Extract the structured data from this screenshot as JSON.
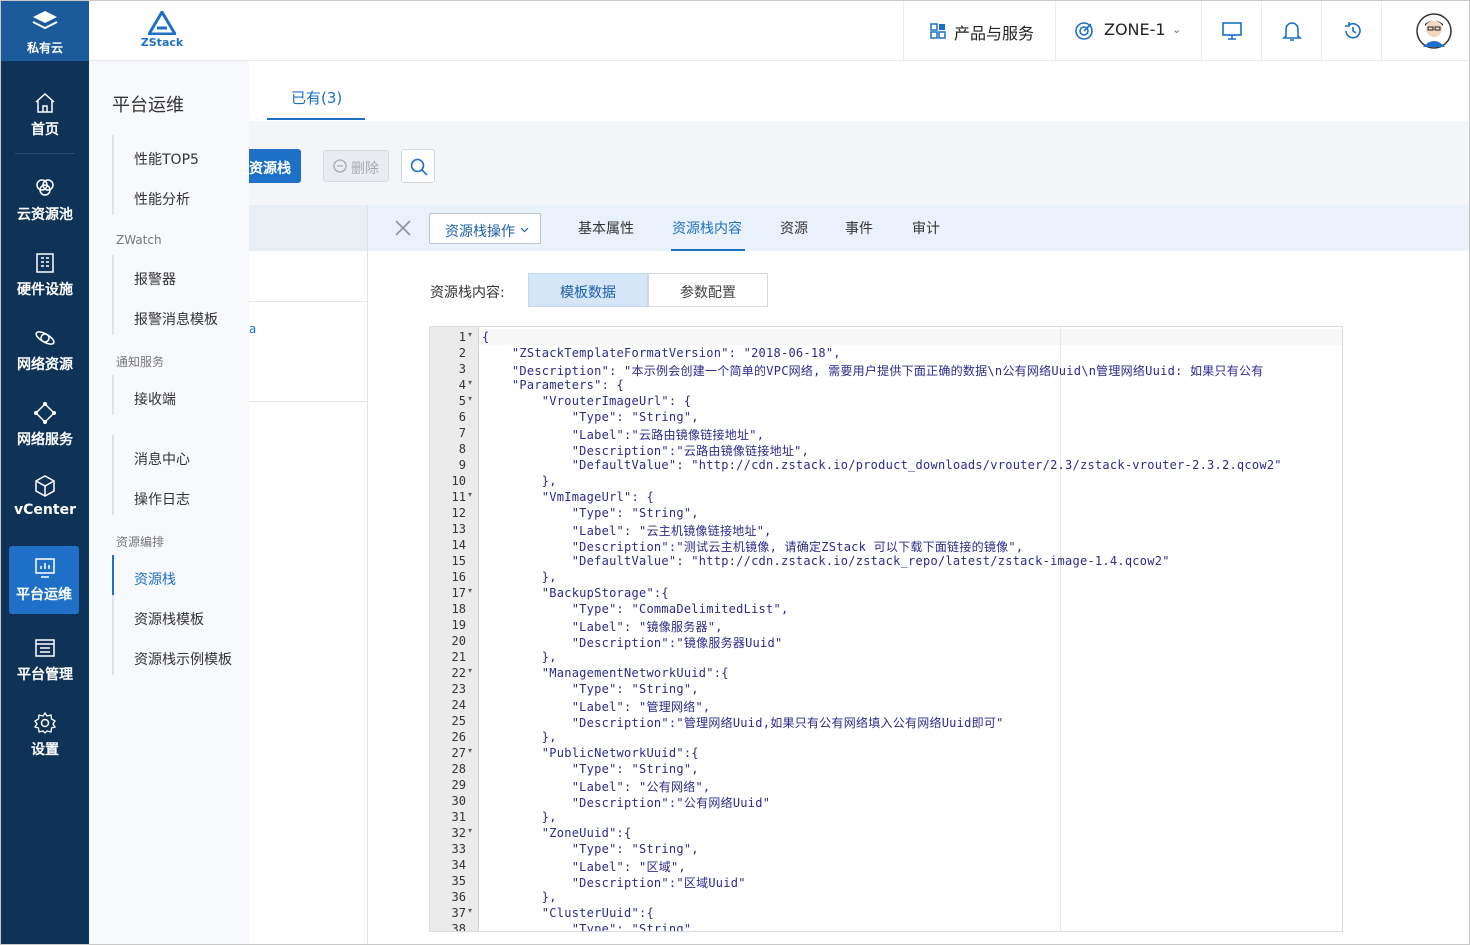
{
  "rail": {
    "top_label": "私有云",
    "items": [
      {
        "label": "首页",
        "icon": "home-icon"
      },
      {
        "label": "云资源池",
        "icon": "resource-pool-icon"
      },
      {
        "label": "硬件设施",
        "icon": "hardware-icon"
      },
      {
        "label": "网络资源",
        "icon": "network-resource-icon"
      },
      {
        "label": "网络服务",
        "icon": "network-service-icon"
      },
      {
        "label": "vCenter",
        "icon": "cube-icon"
      },
      {
        "label": "平台运维",
        "icon": "monitor-chart-icon"
      },
      {
        "label": "平台管理",
        "icon": "list-window-icon"
      },
      {
        "label": "设置",
        "icon": "gear-icon"
      }
    ],
    "active": "平台运维"
  },
  "header": {
    "logo_text": "ZStack",
    "products_label": "产品与服务",
    "zone_label": "ZONE-1"
  },
  "subnav": {
    "title": "平台运维",
    "items": [
      "性能TOP5",
      "性能分析",
      "报警器",
      "报警消息模板",
      "接收端",
      "消息中心",
      "操作日志",
      "资源栈",
      "资源栈模板",
      "资源栈示例模板"
    ],
    "groups": [
      "ZWatch",
      "通知服务",
      "资源编排"
    ]
  },
  "main": {
    "tab_have": "已有(3)",
    "create_btn": "资源栈",
    "delete_btn": "删除",
    "list_partial_text": "a"
  },
  "detail": {
    "ops_btn": "资源栈操作",
    "tabs": [
      "基本属性",
      "资源栈内容",
      "资源",
      "事件",
      "审计"
    ],
    "active_tab": "资源栈内容",
    "content_label": "资源栈内容:",
    "seg_template": "模板数据",
    "seg_params": "参数配置"
  },
  "editor": {
    "lines": [
      "{",
      "    \"ZStackTemplateFormatVersion\": \"2018-06-18\",",
      "    \"Description\": \"本示例会创建一个简单的VPC网络, 需要用户提供下面正确的数据\\n公有网络Uuid\\n管理网络Uuid: 如果只有公有",
      "    \"Parameters\": {",
      "        \"VrouterImageUrl\": {",
      "            \"Type\": \"String\",",
      "            \"Label\":\"云路由镜像链接地址\",",
      "            \"Description\":\"云路由镜像链接地址\",",
      "            \"DefaultValue\": \"http://cdn.zstack.io/product_downloads/vrouter/2.3/zstack-vrouter-2.3.2.qcow2\"",
      "        },",
      "        \"VmImageUrl\": {",
      "            \"Type\": \"String\",",
      "            \"Label\": \"云主机镜像链接地址\",",
      "            \"Description\":\"测试云主机镜像, 请确定ZStack 可以下载下面链接的镜像\",",
      "            \"DefaultValue\": \"http://cdn.zstack.io/zstack_repo/latest/zstack-image-1.4.qcow2\"",
      "        },",
      "        \"BackupStorage\":{",
      "            \"Type\": \"CommaDelimitedList\",",
      "            \"Label\": \"镜像服务器\",",
      "            \"Description\":\"镜像服务器Uuid\"",
      "        },",
      "        \"ManagementNetworkUuid\":{",
      "            \"Type\": \"String\",",
      "            \"Label\": \"管理网络\",",
      "            \"Description\":\"管理网络Uuid,如果只有公有网络填入公有网络Uuid即可\"",
      "        },",
      "        \"PublicNetworkUuid\":{",
      "            \"Type\": \"String\",",
      "            \"Label\": \"公有网络\",",
      "            \"Description\":\"公有网络Uuid\"",
      "        },",
      "        \"ZoneUuid\":{",
      "            \"Type\": \"String\",",
      "            \"Label\": \"区域\",",
      "            \"Description\":\"区域Uuid\"",
      "        },",
      "        \"ClusterUuid\":{",
      "            \"Type\": \"String\","
    ],
    "fold_lines": [
      1,
      4,
      5,
      11,
      17,
      22,
      27,
      32,
      37
    ]
  }
}
